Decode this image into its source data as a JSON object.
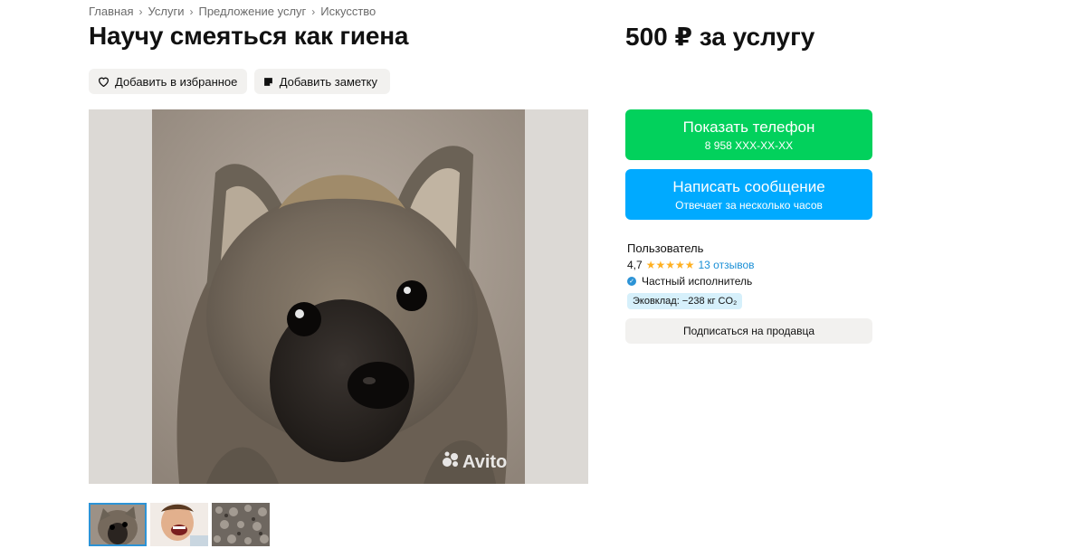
{
  "breadcrumb": [
    "Главная",
    "Услуги",
    "Предложение услуг",
    "Искусство"
  ],
  "listing": {
    "title": "Научу смеяться как гиена",
    "price": "500 ₽ за услугу"
  },
  "actions": {
    "favorite_label": "Добавить в избранное",
    "note_label": "Добавить заметку"
  },
  "gallery": {
    "watermark": "Avito",
    "thumbnails": [
      "hyena",
      "laughing-person",
      "pattern"
    ],
    "active_index": 0
  },
  "contact": {
    "phone_label": "Показать телефон",
    "phone_value": "8 958 XXX-XX-XX",
    "message_label": "Написать сообщение",
    "message_sub": "Отвечает за несколько часов"
  },
  "seller": {
    "name": "Пользователь",
    "rating": "4,7",
    "stars": "★★★★★",
    "reviews": "13 отзывов",
    "type": "Частный исполнитель",
    "eco": "Эковклад: −238 кг CO₂",
    "subscribe_label": "Подписаться на продавца"
  },
  "colors": {
    "green": "#02d15c",
    "blue": "#00aaff",
    "link": "#1a8fd6",
    "star": "#ffb021"
  },
  "icons": {
    "breadcrumb_separator": "chevron-right-icon",
    "favorite": "heart-icon",
    "note": "note-icon",
    "verified": "check-circle-icon"
  }
}
